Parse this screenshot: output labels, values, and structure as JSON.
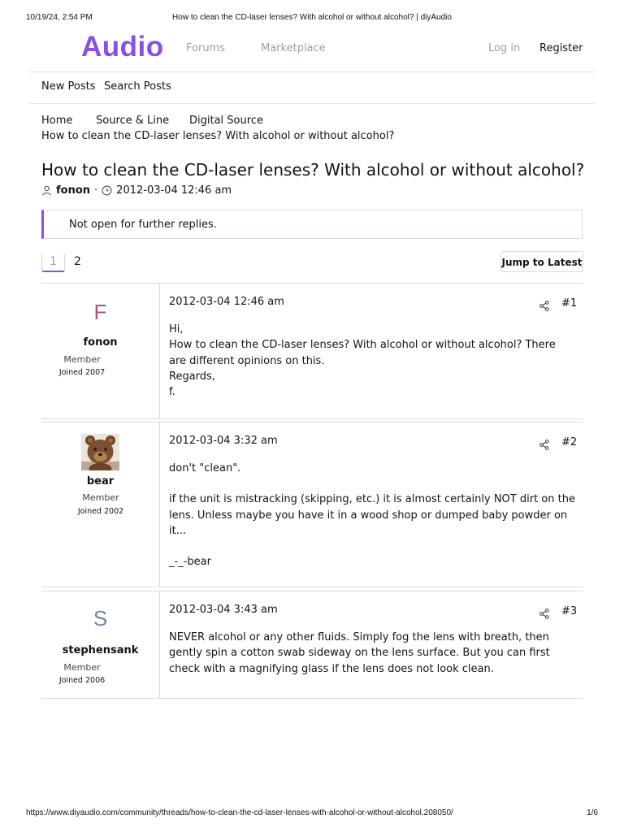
{
  "print": {
    "datetime": "10/19/24, 2:54 PM",
    "doc_title": "How to clean the CD-laser lenses? With alcohol or without alcohol? | diyAudio",
    "url": "https://www.diyaudio.com/community/threads/how-to-clean-the-cd-laser-lenses-with-alcohol-or-without-alcohol.208050/",
    "page": "1/6"
  },
  "nav": {
    "logo": "Audio",
    "forums": "Forums",
    "marketplace": "Marketplace",
    "login": "Log in",
    "register": "Register",
    "accent_color": "#8a4fe6"
  },
  "subnav": {
    "new_posts": "New Posts",
    "search_posts": "Search Posts"
  },
  "breadcrumb": {
    "home": "Home",
    "source_line": "Source & Line",
    "digital_source": "Digital Source",
    "thread": "How to clean the CD-laser lenses? With alcohol or without alcohol?"
  },
  "thread": {
    "title": "How to clean the CD-laser lenses? With alcohol or without alcohol?",
    "author": "fonon",
    "separator": "·",
    "date": "2012-03-04 12:46 am",
    "notice": "Not open for further replies."
  },
  "pagination": {
    "page1": "1",
    "page2": "2",
    "jump_latest": "Jump to Latest"
  },
  "posts": [
    {
      "avatar_letter": "F",
      "avatar_color": "#b0507a",
      "username": "fonon",
      "role": "Member",
      "joined": "Joined 2007",
      "date": "2012-03-04 12:46 am",
      "number": "#1",
      "lines": [
        "Hi,",
        "How to clean the CD-laser lenses? With alcohol or without alcohol? There are different opinions on this.",
        "Regards,",
        "f."
      ]
    },
    {
      "avatar_icon": "teddy-bear-avatar",
      "username": "bear",
      "role": "Member",
      "joined": "Joined 2002",
      "date": "2012-03-04 3:32 am",
      "number": "#2",
      "lines": [
        "don't \"clean\".",
        "if the unit is mistracking (skipping, etc.) it is almost certainly NOT dirt on the lens. Unless maybe you have it in a wood shop or dumped baby powder on it...",
        "_-_-bear"
      ]
    },
    {
      "avatar_letter": "S",
      "avatar_color": "#6f86a8",
      "username": "stephensank",
      "role": "Member",
      "joined": "Joined 2006",
      "date": "2012-03-04 3:43 am",
      "number": "#3",
      "lines": [
        "NEVER alcohol or any other fluids. Simply fog the lens with breath, then gently spin a cotton swab sideway on the lens surface. But you can first check with a magnifying glass if the lens does not look clean."
      ]
    }
  ]
}
